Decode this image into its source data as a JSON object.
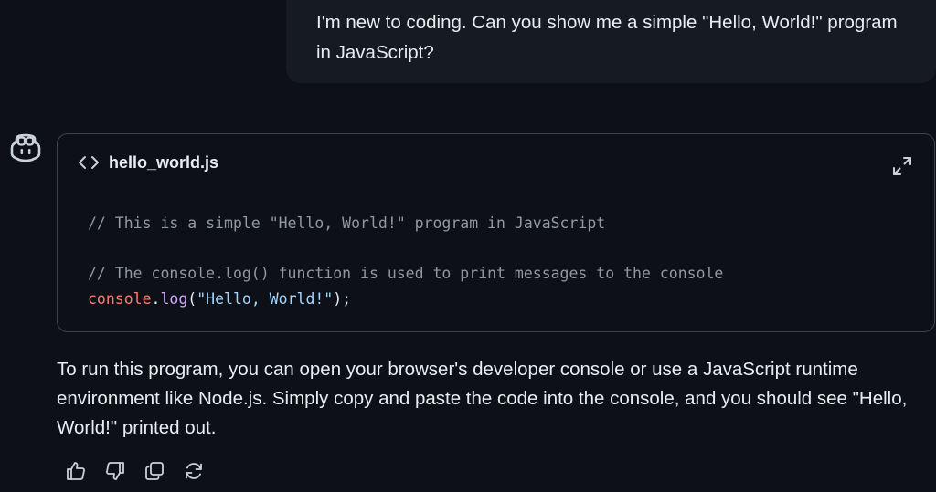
{
  "user_message": {
    "text": "I'm new to coding. Can you show me a simple \"Hello, World!\" program in JavaScript?"
  },
  "assistant": {
    "avatar_icon": "copilot-icon",
    "code_block": {
      "header_icon": "code-icon",
      "filename": "hello_world.js",
      "expand_icon": "expand-icon",
      "lines": {
        "comment1": "// This is a simple \"Hello, World!\" program in JavaScript",
        "comment2": "// The console.log() function is used to print messages to the console",
        "code_object": "console",
        "code_dot": ".",
        "code_method": "log",
        "code_open": "(",
        "code_string": "\"Hello, World!\"",
        "code_close": ");"
      }
    },
    "answer_text": "To run this program, you can open your browser's developer console or use a JavaScript runtime environment like Node.js. Simply copy and paste the code into the console, and you should see \"Hello, World!\" printed out.",
    "actions": [
      "thumbs-up-icon",
      "thumbs-down-icon",
      "copy-icon",
      "retry-icon"
    ]
  },
  "colors": {
    "background": "#0d1117",
    "bubble": "#161b22",
    "border": "#3d444d",
    "comment": "#9198a1",
    "object": "#ff7b72",
    "method": "#d2a8ff",
    "string": "#a5d6ff"
  }
}
